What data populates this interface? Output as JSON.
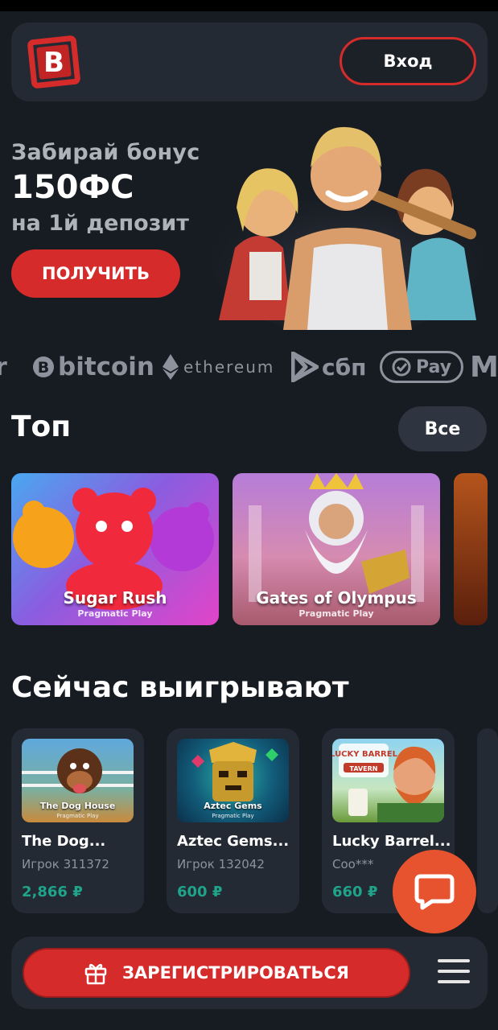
{
  "header": {
    "logo_letter": "B",
    "login_label": "Вход"
  },
  "hero": {
    "title": "Забирай бонус",
    "amount": "150ФС",
    "subtitle": "на 1й депозит",
    "cta_label": "ПОЛУЧИТЬ"
  },
  "payments": [
    "bitcoin",
    "ethereum",
    "сбп",
    "Pay"
  ],
  "top": {
    "title": "Топ",
    "all_label": "Все",
    "games": [
      {
        "name": "Sugar Rush",
        "provider": "Pragmatic Play"
      },
      {
        "name": "Gates of Olympus",
        "provider": "Pragmatic Play"
      }
    ]
  },
  "winners": {
    "title": "Сейчас выигрывают",
    "items": [
      {
        "thumb_title": "The Dog House",
        "thumb_provider": "Pragmatic Play",
        "name": "The Dog...",
        "player": "Игрок 311372",
        "amount": "2,866 ₽"
      },
      {
        "thumb_title": "Aztec Gems",
        "thumb_provider": "Pragmatic Play",
        "name": "Aztec Gems...",
        "player": "Игрок 132042",
        "amount": "600 ₽"
      },
      {
        "thumb_title": "LUCKY BARREL",
        "thumb_provider": "TAVERN",
        "name": "Lucky Barrel...",
        "player": "Coo***",
        "amount": "660 ₽"
      }
    ]
  },
  "bottom": {
    "register_label": "ЗАРЕГИСТРИРОВАТЬСЯ"
  },
  "colors": {
    "accent": "#d62b2b",
    "win_green": "#1fa38a",
    "chat": "#e8532f",
    "bg": "#171b22",
    "card": "#242a33"
  }
}
